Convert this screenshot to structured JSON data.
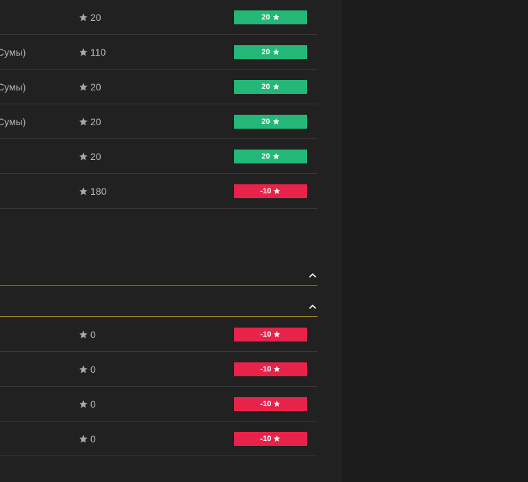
{
  "colors": {
    "panel_bg": "#212121",
    "page_bg": "#1b1b1b",
    "text": "#b9b9b9",
    "green": "#23b877",
    "red": "#e8234a",
    "divider_blue": "#4a5fd0",
    "divider_yellow": "#e8b830"
  },
  "top_rows": [
    {
      "name": "",
      "points": "20",
      "badge": "20",
      "badge_color": "green"
    },
    {
      "name": "Сумы)",
      "points": "110",
      "badge": "20",
      "badge_color": "green"
    },
    {
      "name": "Сумы)",
      "points": "20",
      "badge": "20",
      "badge_color": "green"
    },
    {
      "name": "Сумы)",
      "points": "20",
      "badge": "20",
      "badge_color": "green"
    },
    {
      "name": "",
      "points": "20",
      "badge": "20",
      "badge_color": "green"
    },
    {
      "name": "",
      "points": "180",
      "badge": "-10",
      "badge_color": "red"
    }
  ],
  "sections": [
    {
      "icon": "chevron-up-icon",
      "divider_color": "blue"
    },
    {
      "icon": "chevron-up-icon",
      "divider_color": "yellow"
    }
  ],
  "bottom_rows": [
    {
      "name": "",
      "points": "0",
      "badge": "-10",
      "badge_color": "red"
    },
    {
      "name": "",
      "points": "0",
      "badge": "-10",
      "badge_color": "red"
    },
    {
      "name": "",
      "points": "0",
      "badge": "-10",
      "badge_color": "red"
    },
    {
      "name": "",
      "points": "0",
      "badge": "-10",
      "badge_color": "red"
    }
  ]
}
